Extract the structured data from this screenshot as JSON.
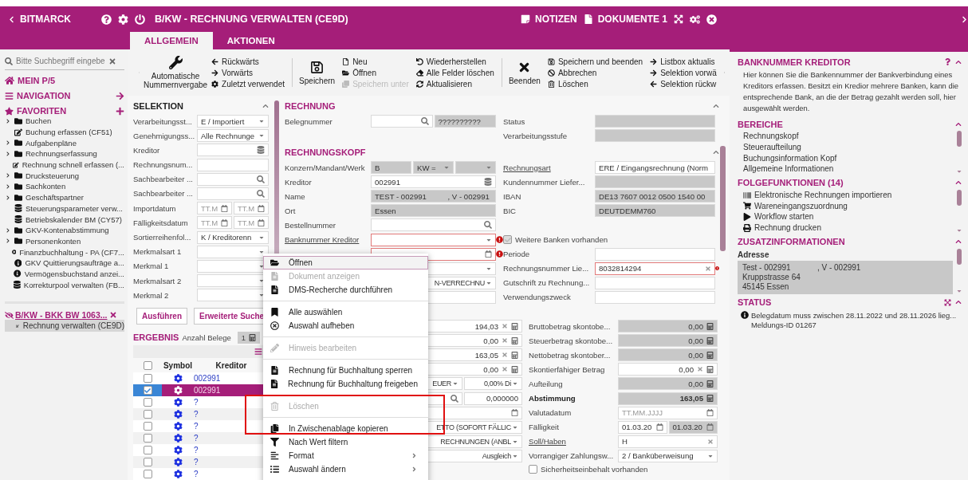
{
  "header": {
    "back_label": "BITMARCK",
    "title": "B/KW - RECHNUNG VERWALTEN (CE9D)",
    "notes_label": "NOTIZEN",
    "documents_label": "DOKUMENTE 1"
  },
  "tabs": [
    {
      "label": "ALLGEMEIN",
      "selected": true
    },
    {
      "label": "AKTIONEN",
      "selected": false
    }
  ],
  "sidebar": {
    "search": {
      "placeholder": "Bitte Suchbegriff eingebe"
    },
    "home": "MEIN P/5",
    "navigation": "NAVIGATION",
    "favorites": "FAVORITEN",
    "favorite_items": [
      {
        "kind": "folder",
        "label": "Buchen",
        "expanded": false
      },
      {
        "kind": "edit",
        "label": "Buchung erfassen (CF51)"
      },
      {
        "kind": "folder",
        "label": "Aufgabenpläne",
        "expanded": false
      },
      {
        "kind": "folder",
        "label": "Rechnungserfassung",
        "expanded": false
      },
      {
        "kind": "edit",
        "label": "Rechnung schnell erfassen (..."
      },
      {
        "kind": "folder",
        "label": "Drucksteuerung",
        "expanded": false
      },
      {
        "kind": "folder",
        "label": "Sachkonten",
        "expanded": false
      },
      {
        "kind": "folder",
        "label": "Geschäftspartner",
        "expanded": false
      },
      {
        "kind": "db",
        "label": "Steuerungsparameter verw..."
      },
      {
        "kind": "db",
        "label": "Betriebskalender BM (CY57)"
      },
      {
        "kind": "folder",
        "label": "GKV-Kontenabstimmung",
        "expanded": false
      },
      {
        "kind": "folder",
        "label": "Personenkonten",
        "expanded": false
      },
      {
        "kind": "play",
        "label": "Finanzbuchhaltung - PA (CF7..."
      },
      {
        "kind": "info",
        "label": "GKV Quittierungsaufträge a..."
      },
      {
        "kind": "info",
        "label": "Vermögensbuchstand anzei..."
      },
      {
        "kind": "db",
        "label": "Korrekturpool verwalten (FB..."
      }
    ],
    "open_session": {
      "label": "B/KW - BKK BW 1063...",
      "items": [
        {
          "label": "Rechnung verwalten (CE9D)",
          "selected": true
        }
      ]
    }
  },
  "toolbar": {
    "groups": [
      {
        "large": {
          "kind": "wrench",
          "label": "Automatische Nummernvergabe"
        },
        "columns": [
          [
            {
              "kind": "back",
              "label": "Rückwärts",
              "disabled": false
            },
            {
              "kind": "forward",
              "label": "Vorwärts",
              "disabled": false
            },
            {
              "kind": "gear",
              "label": "Zuletzt verwendet",
              "disabled": false
            }
          ]
        ]
      },
      {
        "large": {
          "kind": "save",
          "label": "Speichern"
        },
        "columns": [
          [
            {
              "kind": "new",
              "label": "Neu",
              "disabled": false
            },
            {
              "kind": "open",
              "label": "Öffnen",
              "disabled": false
            },
            {
              "kind": "save-as",
              "label": "Speichern unter",
              "disabled": true
            }
          ],
          [
            {
              "kind": "undo",
              "label": "Wiederherstellen",
              "disabled": false
            },
            {
              "kind": "eraser",
              "label": "Alle Felder löschen",
              "disabled": false
            },
            {
              "kind": "refresh",
              "label": "Aktualisieren",
              "disabled": false
            }
          ]
        ]
      },
      {
        "large": {
          "kind": "close",
          "label": "Beenden"
        },
        "columns": [
          [
            {
              "kind": "save-small",
              "label": "Speichern und beenden",
              "disabled": false
            },
            {
              "kind": "cancel",
              "label": "Abbrechen",
              "disabled": false
            },
            {
              "kind": "trash",
              "label": "Löschen",
              "disabled": false
            }
          ],
          [
            {
              "kind": "forward",
              "label": "Listbox aktualis",
              "disabled": false
            },
            {
              "kind": "forward",
              "label": "Selektion vorwä",
              "disabled": false
            },
            {
              "kind": "back",
              "label": "Selektion rückw",
              "disabled": false
            }
          ]
        ]
      }
    ]
  },
  "selection": {
    "title": "SELEKTION",
    "rows": [
      {
        "label": "Verarbeitungsst...",
        "fields": [
          {
            "kind": "select",
            "value": "E / Importiert"
          }
        ]
      },
      {
        "label": "Genehmigungss...",
        "fields": [
          {
            "kind": "select",
            "value": "Alle Rechnunge"
          }
        ]
      },
      {
        "label": "Kreditor",
        "fields": [
          {
            "kind": "db"
          }
        ]
      },
      {
        "label": "Rechnungsnum...",
        "fields": [
          {
            "kind": "text"
          }
        ]
      },
      {
        "label": "Sachbearbeiter ...",
        "fields": [
          {
            "kind": "search"
          }
        ]
      },
      {
        "label": "Sachbearbeiter ...",
        "fields": [
          {
            "kind": "search"
          }
        ]
      },
      {
        "label": "Importdatum",
        "fields": [
          {
            "kind": "date",
            "placeholder": "TT.M"
          },
          {
            "kind": "date",
            "placeholder": "TT.M"
          }
        ]
      },
      {
        "label": "Fälligkeitsdatum",
        "fields": [
          {
            "kind": "date",
            "placeholder": "TT.M"
          },
          {
            "kind": "date",
            "placeholder": "TT.M"
          }
        ]
      },
      {
        "label": "Sortierreihenfol...",
        "fields": [
          {
            "kind": "select",
            "value": "K / Kreditorenn"
          }
        ]
      },
      {
        "label": "Merkmalsart 1",
        "fields": [
          {
            "kind": "select"
          }
        ]
      },
      {
        "label": "Merkmal 1",
        "fields": [
          {
            "kind": "select"
          }
        ]
      },
      {
        "label": "Merkmalsart 2",
        "fields": [
          {
            "kind": "select"
          }
        ]
      },
      {
        "label": "Merkmal 2",
        "fields": [
          {
            "kind": "select"
          }
        ]
      }
    ],
    "buttons": [
      "Ausführen",
      "Erweiterte Suche"
    ]
  },
  "result": {
    "title": "ERGEBNIS",
    "count_label": "Anzahl Belege",
    "count": "1",
    "all_checked": false,
    "columns": [
      "Symbol",
      "Kreditor"
    ],
    "rows": [
      {
        "checked": false,
        "selected": false,
        "kreditor": "002991"
      },
      {
        "checked": true,
        "selected": true,
        "kreditor": "002991"
      },
      {
        "checked": false,
        "selected": false,
        "kreditor": "?"
      },
      {
        "checked": false,
        "selected": false,
        "kreditor": "?"
      },
      {
        "checked": false,
        "selected": false,
        "kreditor": "?"
      },
      {
        "checked": false,
        "selected": false,
        "kreditor": "?"
      },
      {
        "checked": false,
        "selected": false,
        "kreditor": "?"
      },
      {
        "checked": false,
        "selected": false,
        "kreditor": "?"
      },
      {
        "checked": false,
        "selected": false,
        "kreditor": "?"
      }
    ]
  },
  "rechnung": {
    "title": "RECHNUNG",
    "rows": [
      {
        "left": {
          "label": "Belegnummer",
          "fields": [
            {
              "kind": "search"
            },
            {
              "kind": "readonly",
              "value": "??????????"
            }
          ]
        },
        "right": {
          "label": "Status",
          "fields": [
            {
              "kind": "readonly"
            }
          ]
        }
      },
      {
        "right": {
          "label": "Verarbeitungsstufe",
          "fields": [
            {
              "kind": "readonly"
            }
          ]
        }
      }
    ]
  },
  "rechnungskopf": {
    "title": "RECHNUNGSKOPF",
    "rows": [
      {
        "left": {
          "label": "Konzern/Mandant/Werk",
          "fields": [
            {
              "kind": "readonly",
              "value": "B"
            },
            {
              "kind": "readonly-select",
              "value": "KW ="
            },
            {
              "kind": "readonly-select"
            }
          ]
        },
        "right": {
          "label": "Rechnungsart",
          "link": true,
          "fields": [
            {
              "kind": "select",
              "value": "ERE / Eingangsrechnung (Norm"
            }
          ]
        }
      },
      {
        "left": {
          "label": "Kreditor",
          "fields": [
            {
              "kind": "db",
              "value": "002991"
            }
          ]
        },
        "right": {
          "label": "Kundennummer Liefer...",
          "fields": [
            {
              "kind": "readonly"
            }
          ]
        }
      },
      {
        "left": {
          "label": "Name",
          "fields": [
            {
              "kind": "readonly",
              "value": "TEST - 002991          , V - 002991"
            }
          ]
        },
        "right": {
          "label": "IBAN",
          "fields": [
            {
              "kind": "readonly",
              "value": "DE13 7607 0012 0500 1540 00"
            }
          ]
        }
      },
      {
        "left": {
          "label": "Ort",
          "fields": [
            {
              "kind": "readonly",
              "value": "Essen"
            }
          ]
        },
        "right": {
          "label": "BIC",
          "fields": [
            {
              "kind": "readonly",
              "value": "DEUTDEMM760"
            }
          ]
        }
      },
      {
        "left": {
          "label": "Bestellnummer",
          "fields": [
            {
              "kind": "search"
            }
          ]
        }
      },
      {
        "left": {
          "label": "Banknummer Kreditor",
          "link": true,
          "fields": [
            {
              "kind": "select",
              "error": true
            }
          ]
        },
        "right": {
          "kind": "checkbox",
          "label": "Weitere Banken vorhanden",
          "checked": true,
          "disabled": true
        }
      },
      {
        "left": {
          "fields": [
            {
              "kind": "date",
              "error": true
            }
          ]
        },
        "right": {
          "label": "Periode",
          "fields": [
            {
              "kind": "text"
            }
          ]
        }
      },
      {
        "left": {
          "fields": [
            {
              "kind": "select"
            }
          ]
        },
        "right": {
          "label": "Rechnungsnummer Lie...",
          "fields": [
            {
              "kind": "clear",
              "value": "8032814294",
              "error": true
            }
          ]
        }
      },
      {
        "left": {
          "fields": [
            {
              "kind": "partial-select",
              "value": "N-VERRECHNU"
            }
          ]
        },
        "right": {
          "label": "Gutschrift zu Rechnung...",
          "fields": [
            {
              "kind": "text"
            }
          ]
        }
      },
      {
        "left": {
          "fields": [
            {
              "kind": "text"
            }
          ]
        },
        "right": {
          "label": "Verwendungszweck",
          "fields": [
            {
              "kind": "text"
            }
          ]
        }
      }
    ],
    "amount_rows": [
      {
        "left": {
          "fields": [
            {
              "kind": "amount",
              "value": "194,03"
            }
          ]
        },
        "right": {
          "label": "Bruttobetrag skontobe...",
          "fields": [
            {
              "kind": "readonly-amount",
              "value": "0,00"
            }
          ]
        }
      },
      {
        "left": {
          "fields": [
            {
              "kind": "amount",
              "value": "0,00"
            }
          ]
        },
        "right": {
          "label": "Steuerbetrag skontobe...",
          "fields": [
            {
              "kind": "readonly-amount",
              "value": "0,00"
            }
          ]
        }
      },
      {
        "left": {
          "fields": [
            {
              "kind": "amount",
              "value": "163,05"
            }
          ]
        },
        "right": {
          "label": "Nettobetrag skontober...",
          "fields": [
            {
              "kind": "readonly-amount",
              "value": "0,00"
            }
          ]
        }
      },
      {
        "left": {
          "fields": [
            {
              "kind": "amount",
              "value": "0,00"
            }
          ]
        },
        "right": {
          "label": "Skontierfähiger Betrag",
          "fields": [
            {
              "kind": "amount",
              "value": "0,00"
            }
          ]
        }
      },
      {
        "left": {
          "fields": [
            {
              "kind": "partial-select",
              "value": "EUER"
            },
            {
              "kind": "partial-select",
              "value": "0,00% Di"
            }
          ]
        },
        "right": {
          "label": "Aufteilung",
          "fields": [
            {
              "kind": "readonly-amount",
              "value": "0,00"
            }
          ]
        }
      },
      {
        "left": {
          "fields": [
            {
              "kind": "search"
            },
            {
              "kind": "number",
              "value": "0,000000"
            }
          ]
        },
        "right": {
          "label": "Abstimmung",
          "strong": true,
          "fields": [
            {
              "kind": "readonly-amount",
              "value": "163,05"
            }
          ]
        }
      },
      {
        "left": {
          "fields": [
            {
              "kind": "date"
            }
          ]
        },
        "right": {
          "label": "Valutadatum",
          "fields": [
            {
              "kind": "date",
              "placeholder": "TT.MM.JJJJ"
            }
          ]
        }
      },
      {
        "left": {
          "fields": [
            {
              "kind": "partial-select",
              "value": "ETTO (SOFORT FÄLLIC"
            }
          ]
        },
        "right": {
          "label": "Fälligkeit",
          "fields": [
            {
              "kind": "date",
              "value": "01.03.20"
            },
            {
              "kind": "readonly-date",
              "value": "01.03.20"
            }
          ]
        }
      },
      {
        "left": {
          "fields": [
            {
              "kind": "partial-select",
              "value": "RECHNUNGEN (ANBL"
            }
          ]
        },
        "right": {
          "label": "Soll/Haben",
          "link": true,
          "fields": [
            {
              "kind": "clear",
              "value": "H"
            }
          ]
        }
      },
      {
        "left": {
          "fields": [
            {
              "kind": "partial-select",
              "value": "Ausgleich"
            }
          ]
        },
        "right": {
          "label": "Vorrangiger Zahlungsw...",
          "fields": [
            {
              "kind": "select",
              "value": "2 / Banküberweisung"
            }
          ]
        }
      },
      {
        "right": {
          "kind": "checkbox",
          "label": "Sicherheitseinbehalt vorhanden",
          "checked": false,
          "disabled": false
        }
      }
    ]
  },
  "context_menu": {
    "groups": [
      [
        {
          "kind": "open",
          "label": "Öffnen",
          "selected": true,
          "disabled": false
        },
        {
          "kind": "doc",
          "label": "Dokument anzeigen",
          "selected": false,
          "disabled": true
        },
        {
          "kind": "doc",
          "label": "DMS-Recherche durchführen",
          "selected": false,
          "disabled": false
        }
      ],
      [
        {
          "kind": "bookmark",
          "label": "Alle auswählen",
          "selected": false,
          "disabled": false
        },
        {
          "kind": "deselect",
          "label": "Auswahl aufheben",
          "selected": false,
          "disabled": false
        }
      ],
      [
        {
          "kind": "pencil",
          "label": "Hinweis bearbeiten",
          "selected": false,
          "disabled": true
        }
      ],
      [
        {
          "kind": "doc",
          "label": "Rechnung für Buchhaltung sperren",
          "selected": false,
          "disabled": false
        },
        {
          "kind": "doc",
          "label": "Rechnung für Buchhaltung freigeben",
          "selected": false,
          "disabled": false
        }
      ],
      [
        {
          "kind": "trash",
          "label": "Löschen",
          "selected": false,
          "disabled": true
        }
      ],
      [
        {
          "kind": "copy",
          "label": "In Zwischenablage kopieren",
          "selected": false,
          "disabled": false
        },
        {
          "kind": "filter",
          "label": "Nach Wert filtern",
          "selected": false,
          "disabled": false
        },
        {
          "kind": "format",
          "label": "Format",
          "selected": false,
          "disabled": false,
          "submenu": true
        },
        {
          "kind": "list",
          "label": "Auswahl ändern",
          "selected": false,
          "disabled": false,
          "submenu": true
        }
      ]
    ]
  },
  "help": {
    "title": "BANKNUMMER KREDITOR",
    "text": "Hier können Sie die Bankennummer der Bankverbindung eines Kreditors erfassen. Besitzt ein Kredior mehrere Banken, kann die entsprechende Bank, an die der Betrag gezahlt werden soll, hier ausgewählt werden."
  },
  "areas": {
    "title": "BEREICHE",
    "items": [
      "Rechnungskopf",
      "Steueraufteilung",
      "Buchungsinformation Kopf",
      "Allgemeine Informationen"
    ]
  },
  "follow_up": {
    "title": "FOLGEFUNKTIONEN (14)",
    "items": [
      {
        "kind": "barcode",
        "label": "Elektronische Rechnungen importieren"
      },
      {
        "kind": "cart",
        "label": "Wareneingangszuordnung"
      },
      {
        "kind": "play",
        "label": "Workflow starten"
      },
      {
        "kind": "print",
        "label": "Rechnung drucken"
      }
    ]
  },
  "extra_info": {
    "title": "ZUSATZINFORMATIONEN",
    "subtitle": "Adresse",
    "lines": [
      "Test - 002991            , V - 002991",
      "Kruppstrasse 64",
      "45145 Essen"
    ]
  },
  "status": {
    "title": "STATUS",
    "messages": [
      {
        "text": "Belegdatum muss zwischen 28.11.2022 und 28.11.2026 lieg...",
        "id": "Meldungs-ID 01267"
      }
    ]
  }
}
